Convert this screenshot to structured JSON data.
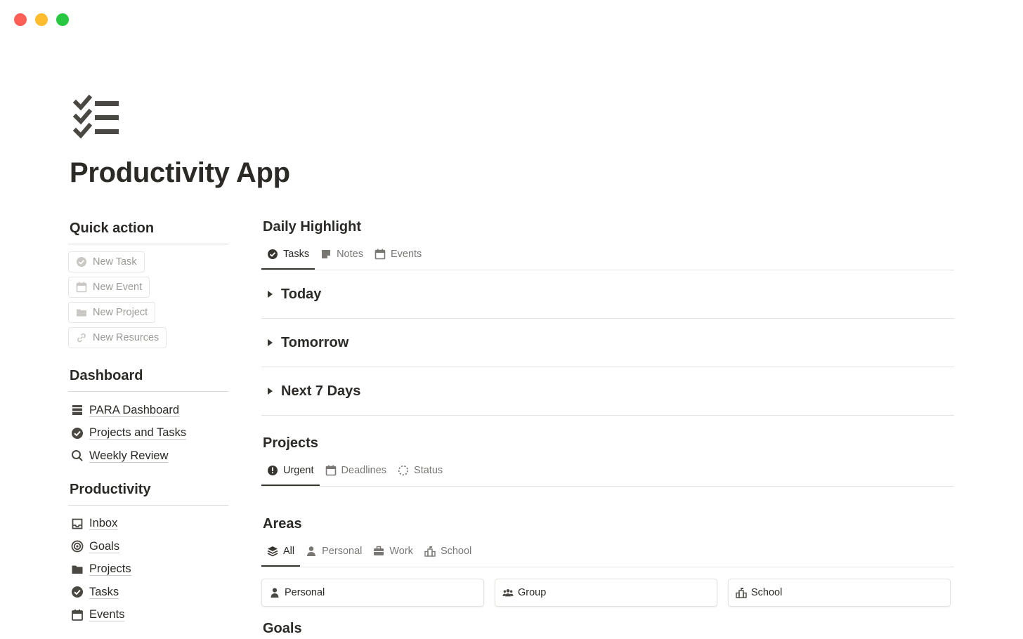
{
  "window": {
    "controls": [
      "#ff5f57",
      "#febc2e",
      "#28c840"
    ]
  },
  "page": {
    "title": "Productivity App",
    "icon": "checklist-icon"
  },
  "quick_action": {
    "heading": "Quick action",
    "buttons": [
      {
        "label": "New Task",
        "icon": "check-circle-icon"
      },
      {
        "label": "New Event",
        "icon": "calendar-icon"
      },
      {
        "label": "New Project",
        "icon": "folder-icon"
      },
      {
        "label": "New Resurces",
        "icon": "link-icon"
      }
    ]
  },
  "dashboard": {
    "heading": "Dashboard",
    "items": [
      {
        "label": "PARA Dashboard",
        "icon": "archive-icon"
      },
      {
        "label": "Projects and Tasks",
        "icon": "check-circle-icon"
      },
      {
        "label": "Weekly Review",
        "icon": "search-icon"
      }
    ]
  },
  "productivity": {
    "heading": "Productivity",
    "items": [
      {
        "label": "Inbox",
        "icon": "inbox-icon"
      },
      {
        "label": "Goals",
        "icon": "target-icon"
      },
      {
        "label": "Projects",
        "icon": "folder-icon"
      },
      {
        "label": "Tasks",
        "icon": "check-circle-icon"
      },
      {
        "label": "Events",
        "icon": "calendar-icon"
      }
    ]
  },
  "daily_highlight": {
    "heading": "Daily Highlight",
    "tabs": [
      {
        "label": "Tasks",
        "icon": "check-circle-icon",
        "active": true
      },
      {
        "label": "Notes",
        "icon": "note-icon",
        "active": false
      },
      {
        "label": "Events",
        "icon": "calendar-icon",
        "active": false
      }
    ],
    "toggles": [
      "Today",
      "Tomorrow",
      "Next 7 Days"
    ]
  },
  "projects": {
    "heading": "Projects",
    "tabs": [
      {
        "label": "Urgent",
        "icon": "alert-icon",
        "active": true
      },
      {
        "label": "Deadlines",
        "icon": "calendar-icon",
        "active": false
      },
      {
        "label": "Status",
        "icon": "dashed-circle-icon",
        "active": false
      }
    ]
  },
  "areas": {
    "heading": "Areas",
    "tabs": [
      {
        "label": "All",
        "icon": "layers-icon",
        "active": true
      },
      {
        "label": "Personal",
        "icon": "person-icon",
        "active": false
      },
      {
        "label": "Work",
        "icon": "briefcase-icon",
        "active": false
      },
      {
        "label": "School",
        "icon": "school-icon",
        "active": false
      }
    ],
    "cards": [
      {
        "label": "Personal",
        "icon": "person-icon"
      },
      {
        "label": "Group",
        "icon": "group-icon"
      },
      {
        "label": "School",
        "icon": "school-icon"
      }
    ]
  },
  "next_heading_partial": "Goals"
}
